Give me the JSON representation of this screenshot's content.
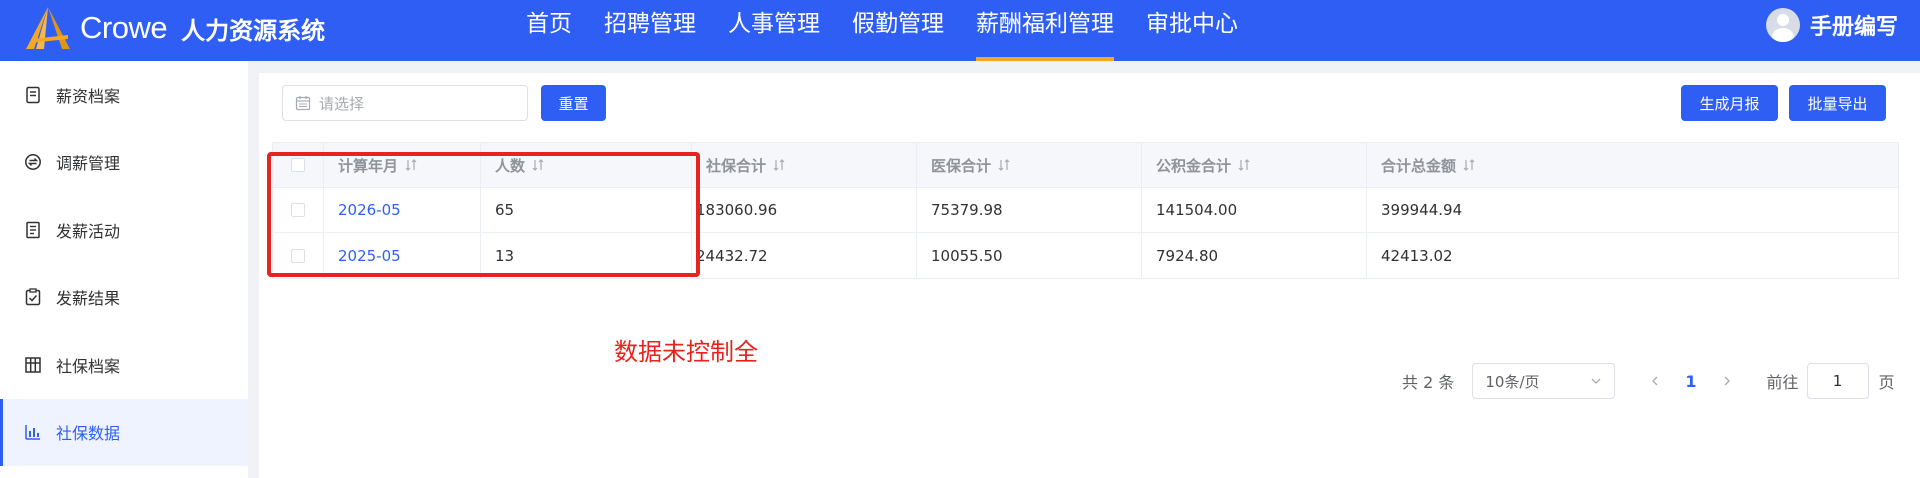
{
  "header": {
    "brand": "Crowe",
    "system_name": "人力资源系统",
    "nav": [
      {
        "label": "首页"
      },
      {
        "label": "招聘管理"
      },
      {
        "label": "人事管理"
      },
      {
        "label": "假勤管理"
      },
      {
        "label": "薪酬福利管理",
        "active": true
      },
      {
        "label": "审批中心"
      }
    ],
    "user_label": "手册编写"
  },
  "sidebar": {
    "items": [
      {
        "label": "薪资档案",
        "icon": "document-icon"
      },
      {
        "label": "调薪管理",
        "icon": "exchange-icon"
      },
      {
        "label": "发薪活动",
        "icon": "list-icon"
      },
      {
        "label": "发薪结果",
        "icon": "clipboard-check-icon"
      },
      {
        "label": "社保档案",
        "icon": "grid-icon"
      },
      {
        "label": "社保数据",
        "icon": "bar-chart-icon",
        "active": true
      }
    ]
  },
  "toolbar": {
    "date_placeholder": "请选择",
    "reset_label": "重置",
    "generate_label": "生成月报",
    "export_label": "批量导出"
  },
  "table": {
    "columns": [
      "计算年月",
      "人数",
      "社保合计",
      "医保合计",
      "公积金合计",
      "合计总金额"
    ],
    "rows": [
      [
        "2026-05",
        "65",
        "183060.96",
        "75379.98",
        "141504.00",
        "399944.94"
      ],
      [
        "2025-05",
        "13",
        "24432.72",
        "10055.50",
        "7924.80",
        "42413.02"
      ]
    ]
  },
  "annotation": "数据未控制全",
  "pagination": {
    "total": "共 2 条",
    "page_size": "10条/页",
    "current_page": "1",
    "goto_prefix": "前往",
    "goto_value": "1",
    "goto_suffix": "页"
  },
  "colors": {
    "primary": "#2f5ef5",
    "accent": "#f5a623",
    "annotation_red": "#e8231f"
  }
}
